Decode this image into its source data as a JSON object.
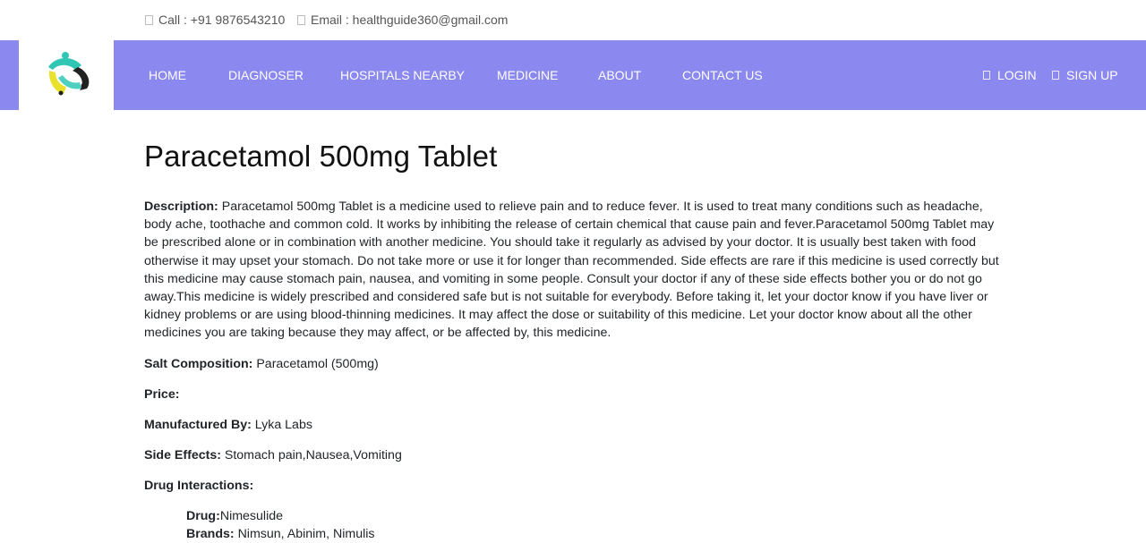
{
  "topbar": {
    "call": "Call : +91 9876543210",
    "email": "Email : healthguide360@gmail.com"
  },
  "nav": {
    "items": [
      "HOME",
      "DIAGNOSER",
      "HOSPITALS NEARBY",
      "MEDICINE",
      "ABOUT",
      "CONTACT US"
    ],
    "login": "LOGIN",
    "signup": "SIGN UP"
  },
  "colors": {
    "nav_bg": "#8b88ef",
    "logo_teal": "#2fc7b4",
    "logo_yellow": "#e9e12b"
  },
  "medicine": {
    "title": "Paracetamol 500mg Tablet",
    "description_label": "Description:",
    "description": "Paracetamol 500mg Tablet is a medicine used to relieve pain and to reduce fever. It is used to treat many conditions such as headache, body ache, toothache and common cold. It works by inhibiting the release of certain chemical that cause pain and fever.Paracetamol 500mg Tablet may be prescribed alone or in combination with another medicine. You should take it regularly as advised by your doctor. It is usually best taken with food otherwise it may upset your stomach. Do not take more or use it for longer than recommended. Side effects are rare if this medicine is used correctly but this medicine may cause stomach pain, nausea, and vomiting in some people. Consult your doctor if any of these side effects bother you or do not go away.This medicine is widely prescribed and considered safe but is not suitable for everybody. Before taking it, let your doctor know if you have liver or kidney problems or are using blood-thinning medicines. It may affect the dose or suitability of this medicine. Let your doctor know about all the other medicines you are taking because they may affect, or be affected by, this medicine.",
    "salt_label": "Salt Composition:",
    "salt": "Paracetamol (500mg)",
    "price_label": "Price:",
    "price": "",
    "manufacturer_label": "Manufactured By:",
    "manufacturer": "Lyka Labs",
    "side_effects_label": "Side Effects:",
    "side_effects": "Stomach pain,Nausea,Vomiting",
    "interactions_label": "Drug Interactions:",
    "interaction": {
      "drug_label": "Drug:",
      "drug": "Nimesulide",
      "brands_label": "Brands:",
      "brands": "Nimsun, Abinim, Nimulis"
    }
  }
}
